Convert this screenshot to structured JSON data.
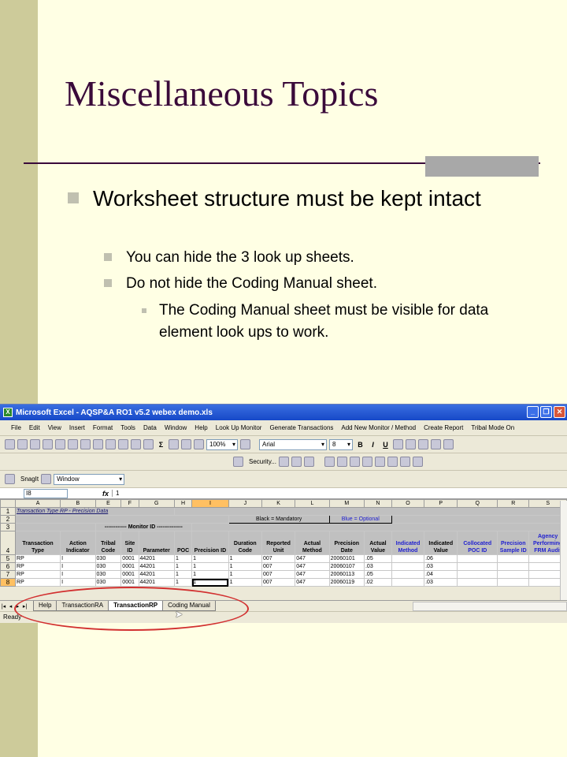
{
  "slide": {
    "title": "Miscellaneous Topics",
    "bullet1": "Worksheet structure must be kept intact",
    "sub1": "You can hide the 3 look up sheets.",
    "sub2": "Do not hide the Coding Manual sheet.",
    "subsub1": "The Coding Manual sheet must be visible for data element look ups to work."
  },
  "excel": {
    "title": "Microsoft Excel - AQSP&A RO1 v5.2 webex demo.xls",
    "menu": [
      "File",
      "Edit",
      "View",
      "Insert",
      "Format",
      "Tools",
      "Data",
      "Window",
      "Help",
      "Look Up Monitor",
      "Generate Transactions",
      "Add New Monitor / Method",
      "Create Report",
      "Tribal Mode On"
    ],
    "zoom": "100%",
    "font": "Arial",
    "font_size": "8",
    "security_label": "Security...",
    "snagit_label": "SnagIt",
    "snagit_window": "Window",
    "name_box": "I8",
    "fx": "fx",
    "formula_value": "1",
    "columns": [
      "A",
      "B",
      "E",
      "F",
      "G",
      "H",
      "I",
      "J",
      "K",
      "L",
      "M",
      "N",
      "O",
      "P",
      "Q",
      "R",
      "S"
    ],
    "row_numbers": [
      "1",
      "2",
      "3",
      "4",
      "5",
      "6",
      "7",
      "8"
    ],
    "sheet_title": "Transaction Type RP - Precision Data",
    "legend_black": "Black = Mandatory",
    "legend_blue": "Blue = Optional",
    "monitor_id_label": "------------ Monitor ID --------------",
    "headers": [
      "Transaction Type",
      "Action Indicator",
      "Tribal Code",
      "Site ID",
      "Parameter",
      "POC",
      "Precision ID",
      "Duration Code",
      "Reported Unit",
      "Actual Method",
      "Precision Date",
      "Actual Value",
      "Indicated Method",
      "Indicated Value",
      "Collocated POC ID",
      "Precision Sample ID",
      "Agency Performing FRM Audit"
    ],
    "rows": [
      [
        "RP",
        "I",
        "030",
        "0001",
        "44201",
        "1",
        "1",
        "1",
        "007",
        "047",
        "20060101",
        ".05",
        "",
        ".06",
        "",
        "",
        ""
      ],
      [
        "RP",
        "I",
        "030",
        "0001",
        "44201",
        "1",
        "1",
        "1",
        "007",
        "047",
        "20060107",
        ".03",
        "",
        ".03",
        "",
        "",
        ""
      ],
      [
        "RP",
        "I",
        "030",
        "0001",
        "44201",
        "1",
        "1",
        "1",
        "007",
        "047",
        "20060113",
        ".05",
        "",
        ".04",
        "",
        "",
        ""
      ],
      [
        "RP",
        "I",
        "030",
        "0001",
        "44201",
        "1",
        "1",
        "1",
        "007",
        "047",
        "20060119",
        ".02",
        "",
        ".03",
        "",
        "",
        ""
      ]
    ],
    "sheet_tabs": [
      "Help",
      "TransactionRA",
      "TransactionRP",
      "Coding Manual"
    ],
    "active_tab": "TransactionRP",
    "status": "Ready",
    "colors": {
      "title_bar": "#1648c8",
      "optional_blue": "#2020d0",
      "highlight_ellipse": "#d23030",
      "slide_title": "#3a0a3a",
      "selected_header": "#ffc062"
    }
  }
}
